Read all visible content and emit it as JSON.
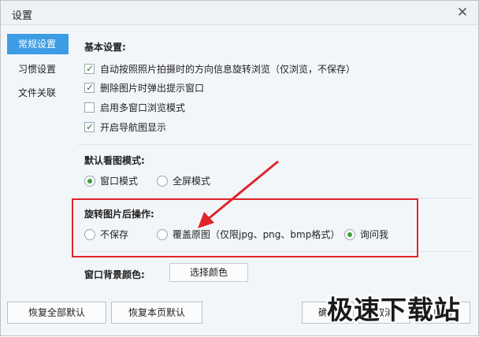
{
  "window": {
    "title": "设置"
  },
  "sidebar": {
    "items": [
      {
        "label": "常规设置",
        "active": true
      },
      {
        "label": "习惯设置",
        "active": false
      },
      {
        "label": "文件关联",
        "active": false
      }
    ]
  },
  "basic": {
    "title": "基本设置:",
    "options": [
      {
        "label": "自动按照照片拍摄时的方向信息旋转浏览（仅浏览，不保存）",
        "checked": true
      },
      {
        "label": "删除图片时弹出提示窗口",
        "checked": true
      },
      {
        "label": "启用多窗口浏览模式",
        "checked": false
      },
      {
        "label": "开启导航图显示",
        "checked": true
      }
    ]
  },
  "view_mode": {
    "title": "默认看图模式:",
    "options": [
      {
        "label": "窗口模式",
        "selected": true
      },
      {
        "label": "全屏模式",
        "selected": false
      }
    ]
  },
  "rotate": {
    "title": "旋转图片后操作:",
    "options": [
      {
        "label": "不保存",
        "selected": false
      },
      {
        "label": "覆盖原图（仅限jpg、png、bmp格式）",
        "selected": false
      },
      {
        "label": "询问我",
        "selected": true
      }
    ]
  },
  "background": {
    "label": "窗口背景颜色:",
    "button": "选择颜色"
  },
  "footer": {
    "restore_all": "恢复全部默认",
    "restore_page": "恢复本页默认",
    "ok": "确定",
    "cancel": "取消",
    "apply": "应用"
  },
  "watermark": "极速下载站",
  "colors": {
    "accent": "#3c9de5",
    "highlight": "#e0262b",
    "check": "#3aa136"
  }
}
